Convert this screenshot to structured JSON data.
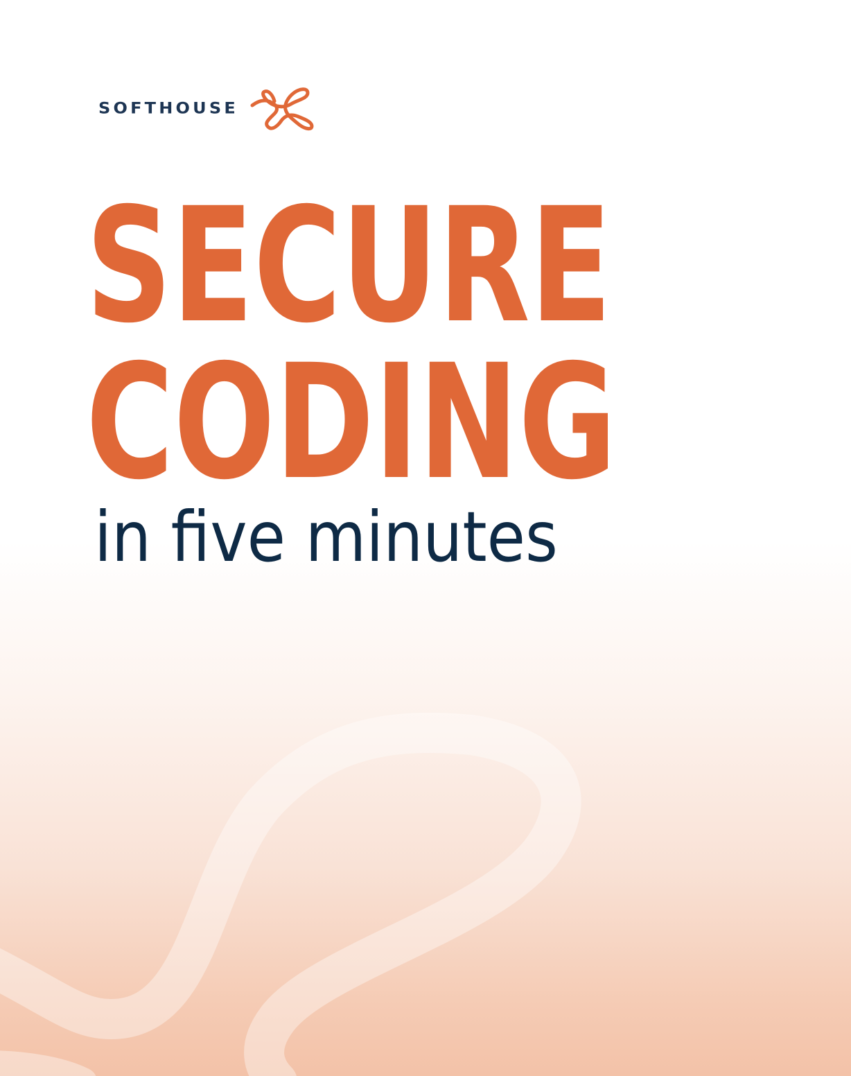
{
  "brand": {
    "name": "SOFTHOUSE",
    "logo_icon": "softhouse-swirl-icon",
    "logo_color": "#e06837",
    "text_color": "#1d3553"
  },
  "cover": {
    "title_line_1": "SECURE",
    "title_line_2": "CODING",
    "subtitle": "in five minutes",
    "title_color": "#e06837",
    "subtitle_color": "#0e2a45",
    "background_top": "#ffffff",
    "background_bottom": "#f3c2a8"
  }
}
